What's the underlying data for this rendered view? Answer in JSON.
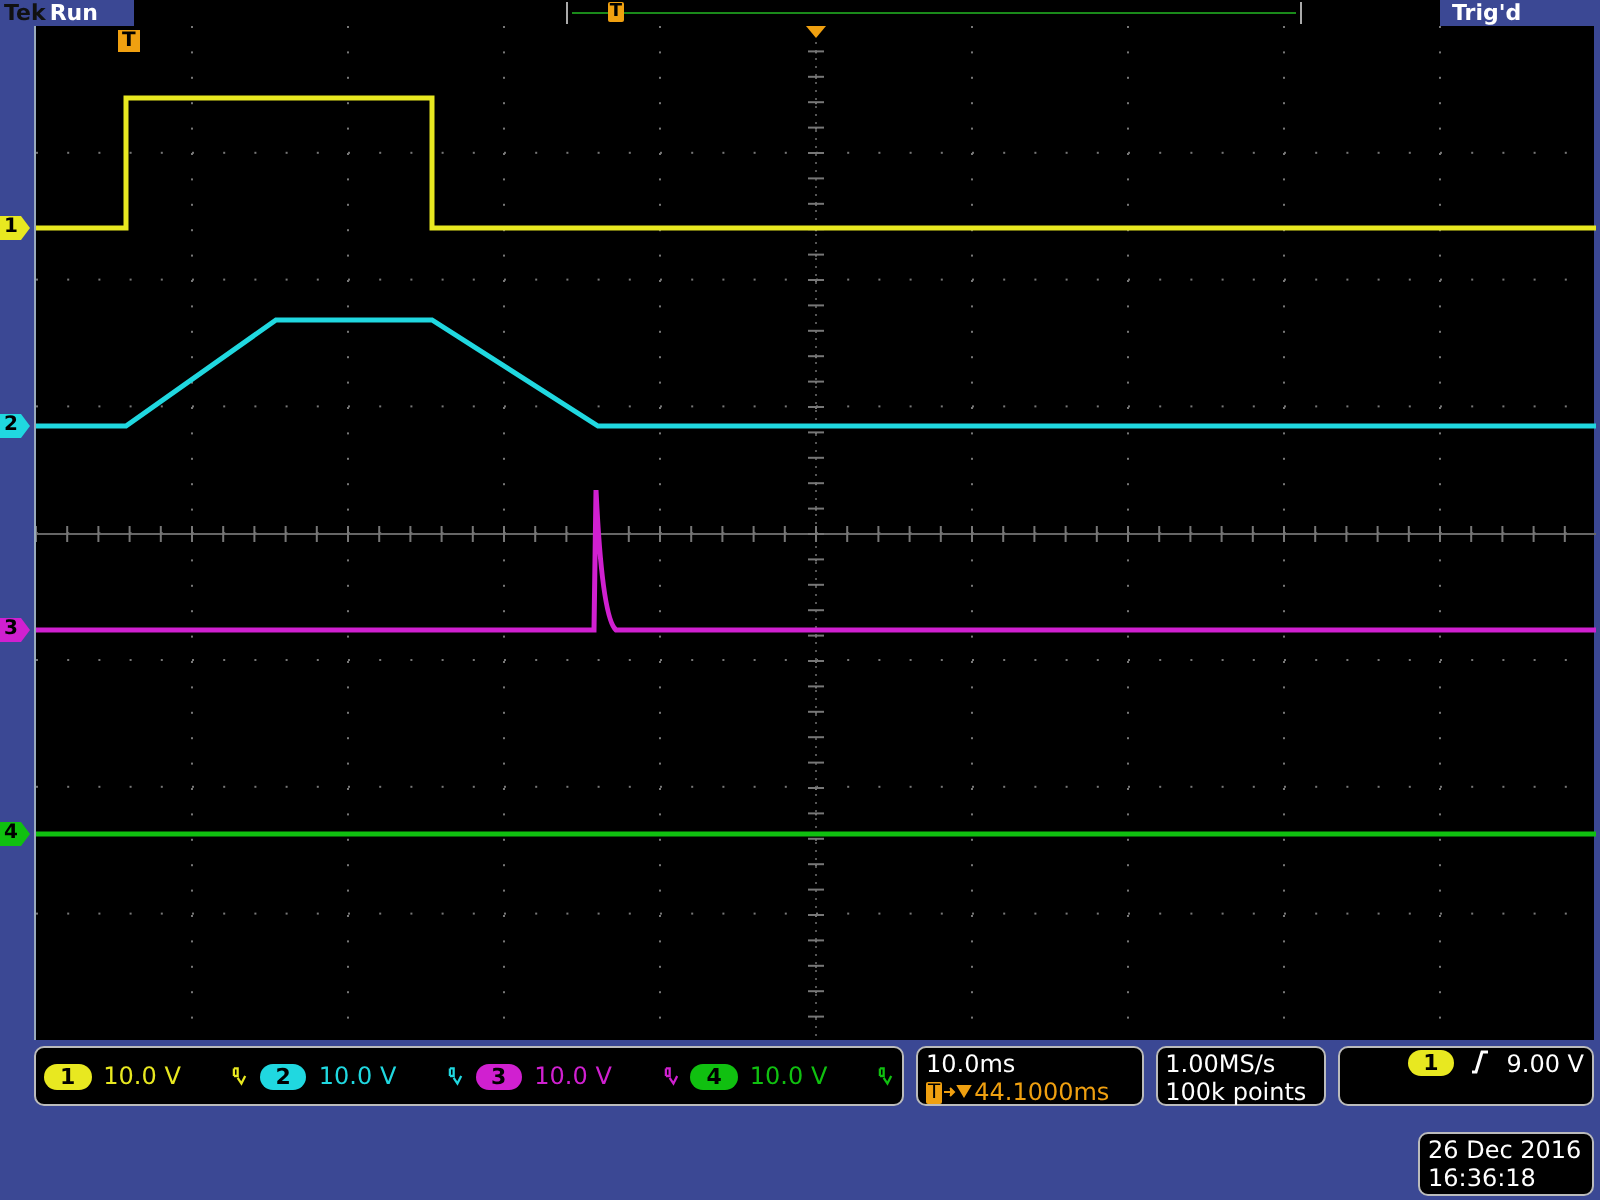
{
  "header": {
    "brand": "Tek",
    "state": "Run",
    "record_marker": "T",
    "trigger_status": "Trig'd"
  },
  "trigger_marker": "T",
  "waveforms": [
    {
      "label": "1",
      "color": "#e8e820"
    },
    {
      "label": "2",
      "color": "#20d8e0"
    },
    {
      "label": "3",
      "color": "#d020d0"
    },
    {
      "label": "4",
      "color": "#10c010"
    }
  ],
  "channels": [
    {
      "label": "1",
      "scale": "10.0 V",
      "color": "#e8e820"
    },
    {
      "label": "2",
      "scale": "10.0 V",
      "color": "#20d8e0"
    },
    {
      "label": "3",
      "scale": "10.0 V",
      "color": "#d020d0"
    },
    {
      "label": "4",
      "scale": "10.0 V",
      "color": "#10c010"
    }
  ],
  "timebase": {
    "scale": "10.0ms",
    "marker": "T",
    "position": "44.1000ms"
  },
  "acquisition": {
    "rate": "1.00MS/s",
    "record_length": "100k points"
  },
  "trigger": {
    "source": "1",
    "level": "9.00 V"
  },
  "timestamp": {
    "date": "26 Dec 2016",
    "time": "16:36:18"
  }
}
